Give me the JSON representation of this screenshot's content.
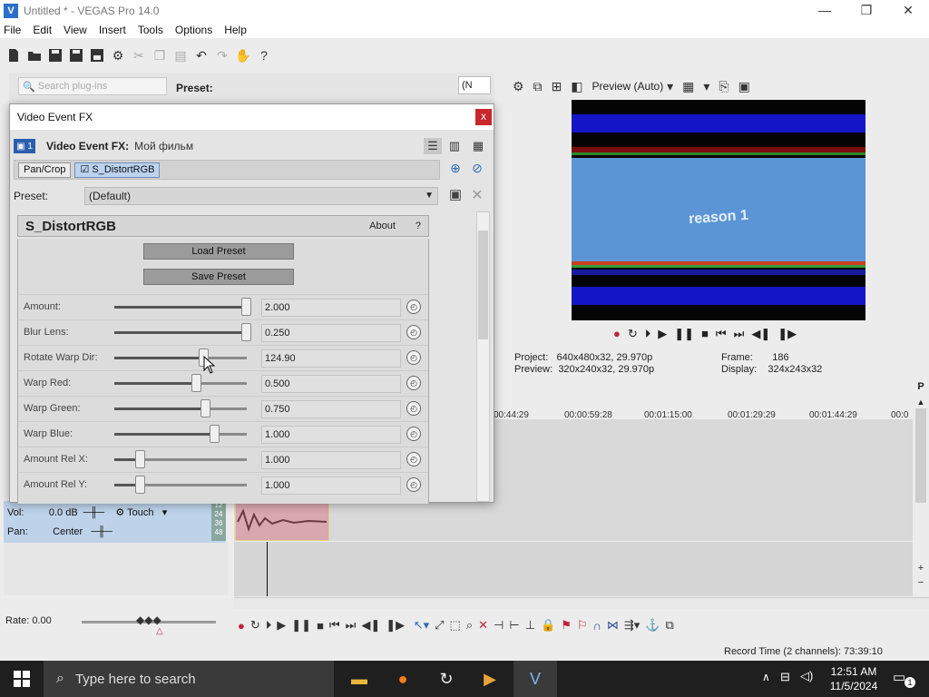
{
  "window": {
    "title": "Untitled * - VEGAS Pro 14.0",
    "logo": "V",
    "minimize": "—",
    "maximize": "❐",
    "close": "✕"
  },
  "menu": [
    "File",
    "Edit",
    "View",
    "Insert",
    "Tools",
    "Options",
    "Help"
  ],
  "plugins": {
    "search_placeholder": "Search plug-ins",
    "preset_label": "Preset:",
    "dropdown_value": "(N"
  },
  "preview": {
    "mode_label": "Preview (Auto)",
    "overlay_text": "reason 1",
    "project_label": "Project:",
    "project_value": "640x480x32, 29.970p",
    "preview_label": "Preview:",
    "preview_value": "320x240x32, 29.970p",
    "frame_label": "Frame:",
    "frame_value": "186",
    "display_label": "Display:",
    "display_value": "324x243x32"
  },
  "timeline": {
    "ruler": [
      "00:44:29",
      "00:00:59:28",
      "00:01:15:00",
      "00:01:29:29",
      "00:01:44:29",
      "00:0"
    ],
    "track": {
      "vol_label": "Vol:",
      "vol_value": "0.0 dB",
      "pan_label": "Pan:",
      "pan_value": "Center",
      "mode": "Touch",
      "meters": [
        "12",
        "24",
        "36",
        "48"
      ]
    },
    "rate": "Rate: 0.00",
    "record_time": "Record Time (2 channels): 73:39:10"
  },
  "dialog": {
    "title": "Video Event FX",
    "close": "x",
    "badge": "1",
    "header_label": "Video Event FX:",
    "media_name": "Мой фильм",
    "chain": [
      "Pan/Crop",
      "S_DistortRGB"
    ],
    "preset_label": "Preset:",
    "preset_value": "(Default)",
    "plugin_name": "S_DistortRGB",
    "about": "About",
    "help": "?",
    "load_preset": "Load Preset",
    "save_preset": "Save Preset",
    "params": [
      {
        "label": "Amount:",
        "value": "2.000",
        "level": 1.0
      },
      {
        "label": "Blur Lens:",
        "value": "0.250",
        "level": 1.0
      },
      {
        "label": "Rotate Warp Dir:",
        "value": "124.90",
        "level": 0.68
      },
      {
        "label": "Warp Red:",
        "value": "0.500",
        "level": 0.62
      },
      {
        "label": "Warp Green:",
        "value": "0.750",
        "level": 0.69
      },
      {
        "label": "Warp Blue:",
        "value": "1.000",
        "level": 0.76
      },
      {
        "label": "Amount Rel X:",
        "value": "1.000",
        "level": 0.2
      },
      {
        "label": "Amount Rel Y:",
        "value": "1.000",
        "level": 0.2
      }
    ]
  },
  "taskbar": {
    "search_placeholder": "Type here to search",
    "time": "12:51 AM",
    "date": "11/5/2024",
    "notifications": "1"
  }
}
